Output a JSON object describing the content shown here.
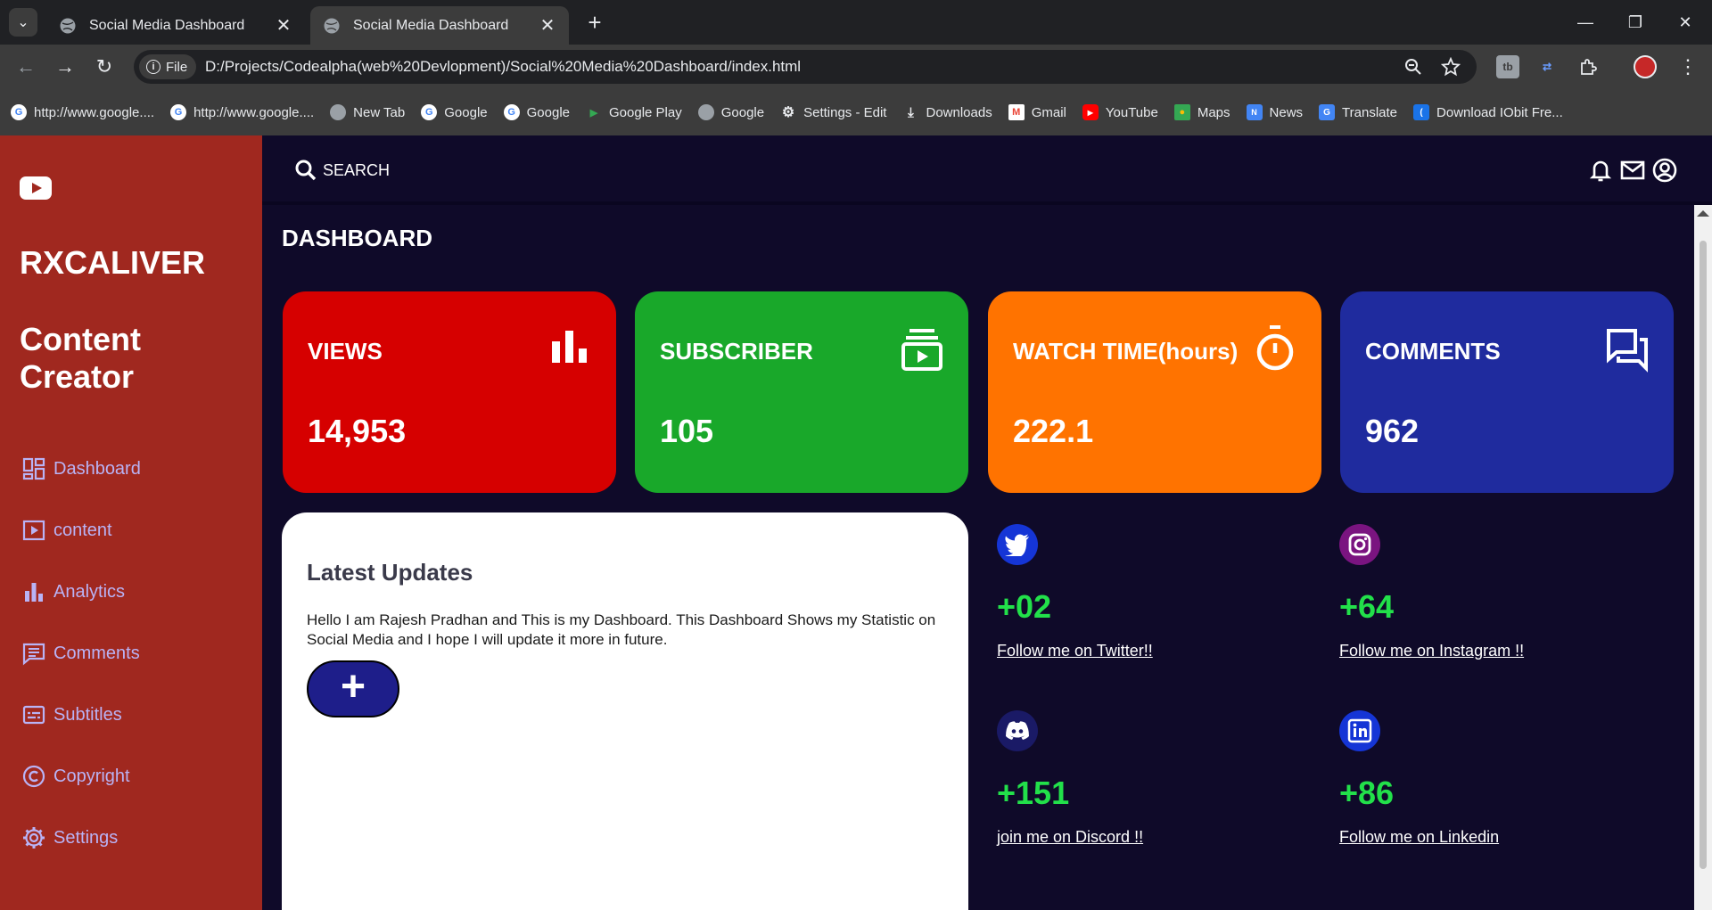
{
  "browser": {
    "tabs": [
      {
        "title": "Social Media Dashboard",
        "active": false
      },
      {
        "title": "Social Media Dashboard",
        "active": true
      }
    ],
    "chip_label": "File",
    "url": "D:/Projects/Codealpha(web%20Devlopment)/Social%20Media%20Dashboard/index.html",
    "bookmarks": [
      {
        "label": "http://www.google....",
        "icon": "google-icon"
      },
      {
        "label": "http://www.google....",
        "icon": "google-icon"
      },
      {
        "label": "New Tab",
        "icon": "globe-icon"
      },
      {
        "label": "Google",
        "icon": "google-icon"
      },
      {
        "label": "Google",
        "icon": "google-icon"
      },
      {
        "label": "Google Play",
        "icon": "google-play-icon"
      },
      {
        "label": "Google",
        "icon": "globe-icon"
      },
      {
        "label": "Settings - Edit",
        "icon": "gear-icon"
      },
      {
        "label": "Downloads",
        "icon": "download-icon"
      },
      {
        "label": "Gmail",
        "icon": "gmail-icon"
      },
      {
        "label": "YouTube",
        "icon": "youtube-icon"
      },
      {
        "label": "Maps",
        "icon": "maps-icon"
      },
      {
        "label": "News",
        "icon": "news-icon"
      },
      {
        "label": "Translate",
        "icon": "translate-icon"
      },
      {
        "label": "Download IObit Fre...",
        "icon": "iobit-icon"
      }
    ]
  },
  "sidebar": {
    "brand": "RXCALIVER",
    "role": "Content Creator",
    "items": [
      {
        "label": "Dashboard",
        "icon": "dashboard-icon"
      },
      {
        "label": "content",
        "icon": "play-box-icon"
      },
      {
        "label": "Analytics",
        "icon": "bar-chart-icon"
      },
      {
        "label": "Comments",
        "icon": "comment-icon"
      },
      {
        "label": "Subtitles",
        "icon": "subtitles-icon"
      },
      {
        "label": "Copyright",
        "icon": "copyright-icon"
      },
      {
        "label": "Settings",
        "icon": "gear-icon"
      }
    ]
  },
  "topbar": {
    "search_label": "SEARCH"
  },
  "main": {
    "heading": "DASHBOARD",
    "cards": [
      {
        "label": "VIEWS",
        "value": "14,953",
        "color": "#d60000",
        "icon": "bar-chart-icon"
      },
      {
        "label": "SUBSCRIBER",
        "value": "105",
        "color": "#19a82a",
        "icon": "subscriptions-icon"
      },
      {
        "label": "WATCH TIME(hours)",
        "value": "222.1",
        "color": "#ff7300",
        "icon": "timer-icon"
      },
      {
        "label": "COMMENTS",
        "value": "962",
        "color": "#1f2b9e",
        "icon": "forum-icon"
      }
    ],
    "updates": {
      "title": "Latest Updates",
      "text": "Hello I am Rajesh Pradhan and This is my Dashboard. This Dashboard Shows my Statistic on Social Media and I hope I will update it more in future.",
      "add_label": "+"
    },
    "socials": [
      {
        "count": "+02",
        "link": "Follow me on Twitter!!",
        "icon": "twitter-icon",
        "color": "#1535d6"
      },
      {
        "count": "+64",
        "link": "Follow me on Instagram !!",
        "icon": "instagram-icon",
        "color": "#7a1480"
      },
      {
        "count": "+151",
        "link": "join me on Discord !!",
        "icon": "discord-icon",
        "color": "#1a1a66"
      },
      {
        "count": "+86",
        "link": "Follow me on Linkedin",
        "icon": "linkedin-icon",
        "color": "#1535d6"
      }
    ],
    "accent_count_color": "#22e04a"
  }
}
